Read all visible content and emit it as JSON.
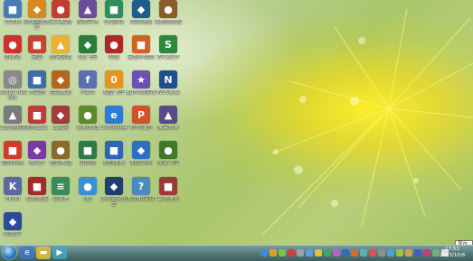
{
  "desktop": {
    "icons": [
      {
        "label": "计算机",
        "glyph": "■",
        "color": "#4a7bb7"
      },
      {
        "label": "网络游戏大厅",
        "glyph": "◆",
        "color": "#d88a1e"
      },
      {
        "label": "天天酷跑",
        "glyph": "●",
        "color": "#c53b2f"
      },
      {
        "label": "游戏中心",
        "glyph": "▲",
        "color": "#6b4d9a"
      },
      {
        "label": "QQ游戏",
        "glyph": "■",
        "color": "#2f8d5b"
      },
      {
        "label": "英雄联盟",
        "glyph": "◆",
        "color": "#1f5e8c"
      },
      {
        "label": "宠物连连看",
        "glyph": "●",
        "color": "#8b5a2b"
      },
      {
        "label": "回收站",
        "glyph": "●",
        "color": "#d22f2f"
      },
      {
        "label": "迅雷",
        "glyph": "■",
        "color": "#c8432d"
      },
      {
        "label": "腾讯游戏",
        "glyph": "▲",
        "color": "#e9b331"
      },
      {
        "label": "QQ飞车",
        "glyph": "◆",
        "color": "#2a7d3a"
      },
      {
        "label": "拳皇",
        "glyph": "●",
        "color": "#b12727"
      },
      {
        "label": "宠物小精灵",
        "glyph": "■",
        "color": "#d2621e"
      },
      {
        "label": "WPS文字",
        "glyph": "S",
        "color": "#2d8a3c"
      },
      {
        "label": "Adobe Reader",
        "glyph": "◎",
        "color": "#8a8a8a"
      },
      {
        "label": "大富翁",
        "glyph": "■",
        "color": "#3d6ca8"
      },
      {
        "label": "金山毒霸",
        "glyph": "◆",
        "color": "#b5651d"
      },
      {
        "label": "Flash",
        "glyph": "f",
        "color": "#5c6fb0"
      },
      {
        "label": "极品飞车",
        "glyph": "0",
        "color": "#e69420"
      },
      {
        "label": "games游戏",
        "glyph": "★",
        "color": "#6e4fb5"
      },
      {
        "label": "WPS表格",
        "glyph": "N",
        "color": "#1d4f91"
      },
      {
        "label": "CS反恐精英",
        "glyph": "▲",
        "color": "#7a7a7a"
      },
      {
        "label": "街头霸王",
        "glyph": "■",
        "color": "#c23a3a"
      },
      {
        "label": "三国志",
        "glyph": "◆",
        "color": "#a33b3b"
      },
      {
        "label": "植物大战",
        "glyph": "●",
        "color": "#5d8a2a"
      },
      {
        "label": "360浏览器",
        "glyph": "e",
        "color": "#2e7bd6"
      },
      {
        "label": "WPS演示",
        "glyph": "P",
        "color": "#d2512a"
      },
      {
        "label": "魔兽世界",
        "glyph": "▲",
        "color": "#5b4a8a"
      },
      {
        "label": "超级玛丽",
        "glyph": "■",
        "color": "#d23a2a"
      },
      {
        "label": "魂斗罗",
        "glyph": "◆",
        "color": "#7a3aa5"
      },
      {
        "label": "坦克大战",
        "glyph": "●",
        "color": "#8a6a2a"
      },
      {
        "label": "冒险岛",
        "glyph": "■",
        "color": "#2f7a4a"
      },
      {
        "label": "控制面板",
        "glyph": "■",
        "color": "#2b65b8"
      },
      {
        "label": "仙剑奇侠",
        "glyph": "◆",
        "color": "#2d6fc0"
      },
      {
        "label": "侠盗飞车",
        "glyph": "●",
        "color": "#3f7a2a"
      },
      {
        "label": "PKPM",
        "glyph": "K",
        "color": "#5a6aa0"
      },
      {
        "label": "红色警戒",
        "glyph": "■",
        "color": "#a52a2a"
      },
      {
        "label": "记事本",
        "glyph": "≡",
        "color": "#3a8a5a"
      },
      {
        "label": "QQ",
        "glyph": "●",
        "color": "#3a90d0"
      },
      {
        "label": "360安全卫士",
        "glyph": "◆",
        "color": "#1f3f6f"
      },
      {
        "label": "帮助和支持",
        "glyph": "?",
        "color": "#4a8ac0"
      },
      {
        "label": "暴力摩托",
        "glyph": "■",
        "color": "#9a3a3a"
      },
      {
        "label": "拳皇97",
        "glyph": "◆",
        "color": "#2a4a9a"
      }
    ]
  },
  "taskbar": {
    "tooltip": "显示桌面",
    "clock_time": "17:51",
    "clock_date": "2013/10/8"
  }
}
